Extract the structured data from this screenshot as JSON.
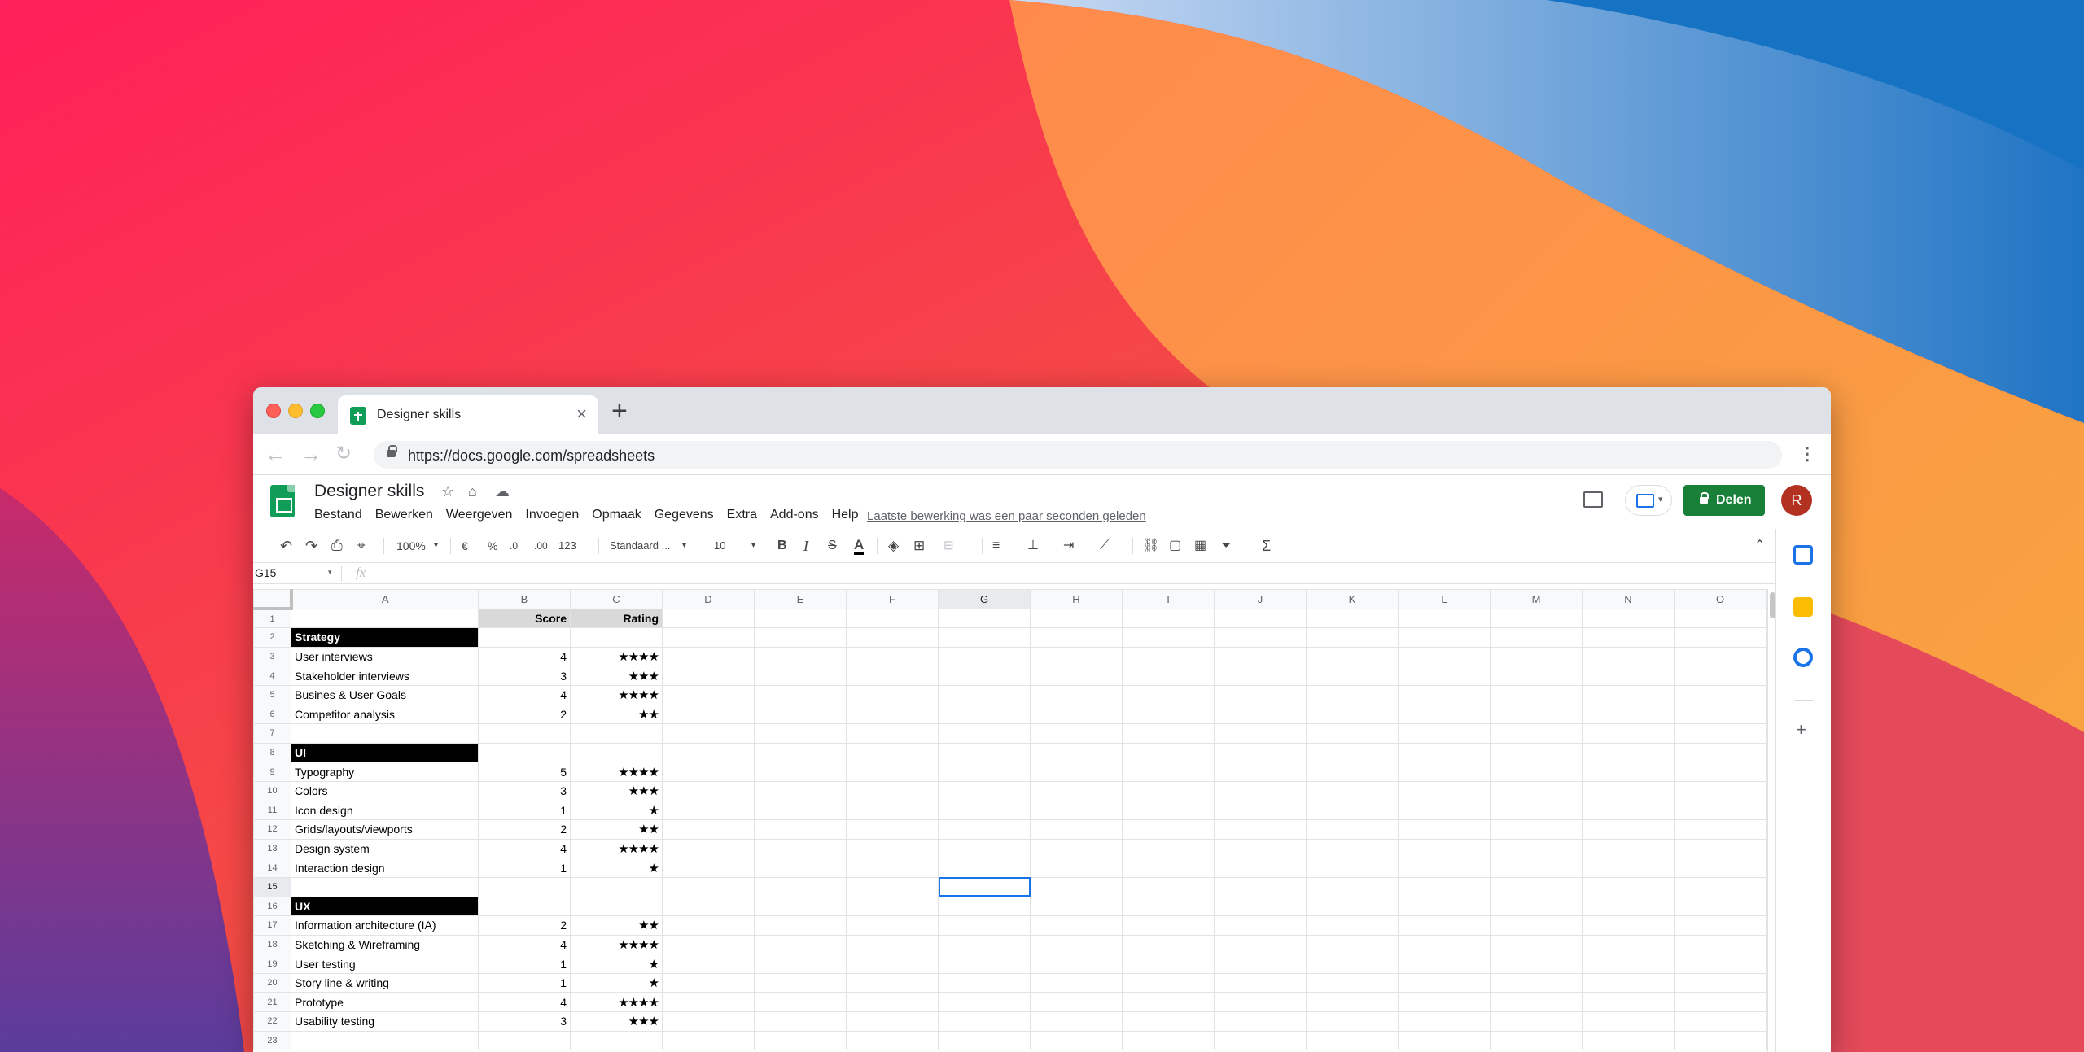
{
  "browser": {
    "tab_title": "Designer skills",
    "tab_close": "×",
    "new_tab": "+",
    "back": "←",
    "forward": "→",
    "reload": "↻",
    "url": "https://docs.google.com/spreadsheets",
    "menu": "⋮"
  },
  "sheets": {
    "doc_title": "Designer skills",
    "star": "☆",
    "move": "⌂",
    "cloud": "☁",
    "menu": [
      "Bestand",
      "Bewerken",
      "Weergeven",
      "Invoegen",
      "Opmaak",
      "Gegevens",
      "Extra",
      "Add-ons",
      "Help"
    ],
    "last_edit": "Laatste bewerking was een paar seconden geleden",
    "share_label": "Delen",
    "avatar_letter": "R",
    "present_caret": "▾"
  },
  "toolbar": {
    "undo": "↶",
    "redo": "↷",
    "print": "⎙",
    "paint_format": "⌖",
    "zoom": "100%",
    "currency": "€",
    "percent": "%",
    "dec_decrease": ".0",
    "dec_increase": ".00",
    "number_format": "123",
    "font": "Standaard ...",
    "font_size": "10",
    "bold": "B",
    "italic": "I",
    "strike": "S",
    "text_color": "A",
    "fill": "◈",
    "borders": "⊞",
    "merge": "⊟",
    "halign": "≡",
    "valign": "⊥",
    "wrap": "⇥",
    "rotate": "⟋",
    "link": "⛓",
    "comment": "▢",
    "chart": "▦",
    "filter": "⏷",
    "function": "Σ",
    "collapse": "⌃",
    "caret": "▾"
  },
  "formula_bar": {
    "cell_ref": "G15",
    "caret": "▾",
    "fx": "fx"
  },
  "grid": {
    "columns": [
      "A",
      "B",
      "C",
      "D",
      "E",
      "F",
      "G",
      "H",
      "I",
      "J",
      "K",
      "L",
      "M",
      "N",
      "O"
    ],
    "active_column": "G",
    "active_row": 15,
    "rows": [
      {
        "n": "1",
        "a": "",
        "b": "Score",
        "c": "Rating",
        "type": "header"
      },
      {
        "n": "2",
        "a": "Strategy",
        "b": "",
        "c": "",
        "type": "section"
      },
      {
        "n": "3",
        "a": "User interviews",
        "b": "4",
        "c": "★★★★",
        "type": "item"
      },
      {
        "n": "4",
        "a": "Stakeholder interviews",
        "b": "3",
        "c": "★★★",
        "type": "item"
      },
      {
        "n": "5",
        "a": "Busines & User Goals",
        "b": "4",
        "c": "★★★★",
        "type": "item"
      },
      {
        "n": "6",
        "a": "Competitor analysis",
        "b": "2",
        "c": "★★",
        "type": "item"
      },
      {
        "n": "7",
        "a": "",
        "b": "",
        "c": "",
        "type": "empty"
      },
      {
        "n": "8",
        "a": "UI",
        "b": "",
        "c": "",
        "type": "section"
      },
      {
        "n": "9",
        "a": "Typography",
        "b": "5",
        "c": "★★★★",
        "type": "item"
      },
      {
        "n": "10",
        "a": "Colors",
        "b": "3",
        "c": "★★★",
        "type": "item"
      },
      {
        "n": "11",
        "a": "Icon design",
        "b": "1",
        "c": "★",
        "type": "item"
      },
      {
        "n": "12",
        "a": "Grids/layouts/viewports",
        "b": "2",
        "c": "★★",
        "type": "item"
      },
      {
        "n": "13",
        "a": "Design system",
        "b": "4",
        "c": "★★★★",
        "type": "item"
      },
      {
        "n": "14",
        "a": "Interaction design",
        "b": "1",
        "c": "★",
        "type": "item"
      },
      {
        "n": "15",
        "a": "",
        "b": "",
        "c": "",
        "type": "empty"
      },
      {
        "n": "16",
        "a": "UX",
        "b": "",
        "c": "",
        "type": "section"
      },
      {
        "n": "17",
        "a": "Information architecture (IA)",
        "b": "2",
        "c": "★★",
        "type": "item"
      },
      {
        "n": "18",
        "a": "Sketching & Wireframing",
        "b": "4",
        "c": "★★★★",
        "type": "item"
      },
      {
        "n": "19",
        "a": "User testing",
        "b": "1",
        "c": "★",
        "type": "item"
      },
      {
        "n": "20",
        "a": "Story line & writing",
        "b": "1",
        "c": "★",
        "type": "item"
      },
      {
        "n": "21",
        "a": "Prototype",
        "b": "4",
        "c": "★★★★",
        "type": "item"
      },
      {
        "n": "22",
        "a": "Usability testing",
        "b": "3",
        "c": "★★★",
        "type": "item"
      },
      {
        "n": "23",
        "a": "",
        "b": "",
        "c": "",
        "type": "empty"
      }
    ]
  },
  "side_panel": {
    "add": "+"
  },
  "colors": {
    "share": "#188038",
    "selection": "#1a73e8",
    "avatar": "#b23121"
  }
}
